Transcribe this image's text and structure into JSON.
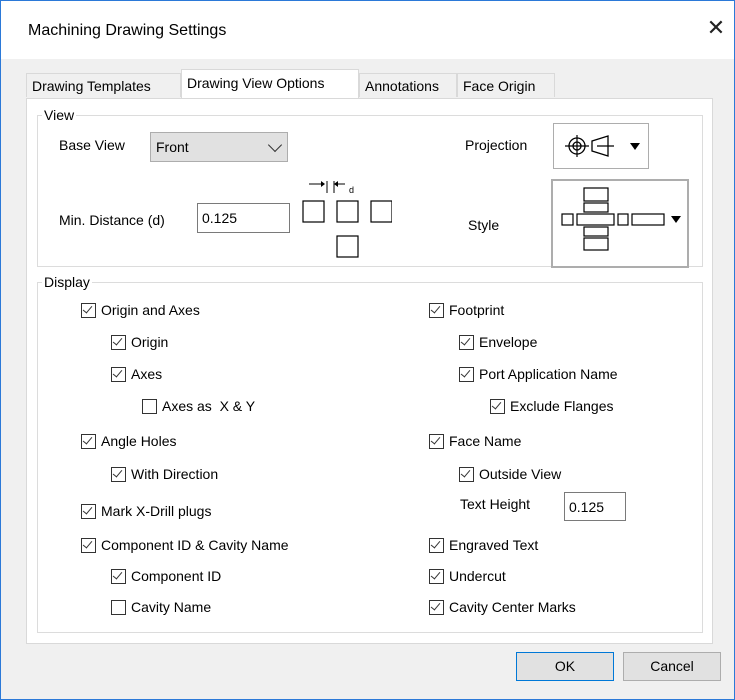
{
  "window": {
    "title": "Machining Drawing Settings",
    "close_glyph": "✕"
  },
  "tabs": [
    "Drawing Templates",
    "Drawing View Options",
    "Annotations",
    "Face Origin"
  ],
  "active_tab": "Drawing View Options",
  "view": {
    "legend": "View",
    "base_view_label": "Base View",
    "base_view_value": "Front",
    "projection_label": "Projection",
    "projection_icon": "first-angle-projection-icon",
    "min_distance_label": "Min. Distance (d)",
    "min_distance_value": "0.125",
    "distance_diagram_label": "d",
    "style_label": "Style",
    "style_icon": "view-layout-style-icon"
  },
  "display": {
    "legend": "Display",
    "origin_and_axes": {
      "label": "Origin and Axes",
      "checked": true
    },
    "origin": {
      "label": "Origin",
      "checked": true
    },
    "axes": {
      "label": "Axes",
      "checked": true
    },
    "axes_as_xy": {
      "label": "Axes as  X & Y",
      "checked": false
    },
    "angle_holes": {
      "label": "Angle Holes",
      "checked": true
    },
    "with_direction": {
      "label": "With Direction",
      "checked": true
    },
    "mark_xdrill": {
      "label": "Mark X-Drill plugs",
      "checked": true
    },
    "component_cavity": {
      "label": "Component ID & Cavity Name",
      "checked": true
    },
    "component_id": {
      "label": "Component ID",
      "checked": true
    },
    "cavity_name": {
      "label": "Cavity Name",
      "checked": false
    },
    "footprint": {
      "label": "Footprint",
      "checked": true
    },
    "envelope": {
      "label": "Envelope",
      "checked": true
    },
    "port_app_name": {
      "label": "Port Application Name",
      "checked": true
    },
    "exclude_flanges": {
      "label": "Exclude Flanges",
      "checked": true
    },
    "face_name": {
      "label": "Face Name",
      "checked": true
    },
    "outside_view": {
      "label": "Outside View",
      "checked": true
    },
    "text_height_label": "Text Height",
    "text_height_value": "0.125",
    "engraved_text": {
      "label": "Engraved Text",
      "checked": true
    },
    "undercut": {
      "label": "Undercut",
      "checked": true
    },
    "cavity_center_marks": {
      "label": "Cavity Center Marks",
      "checked": true
    }
  },
  "buttons": {
    "ok": "OK",
    "cancel": "Cancel"
  },
  "colors": {
    "accent": "#0078d7",
    "window_border": "#2b79d8"
  }
}
